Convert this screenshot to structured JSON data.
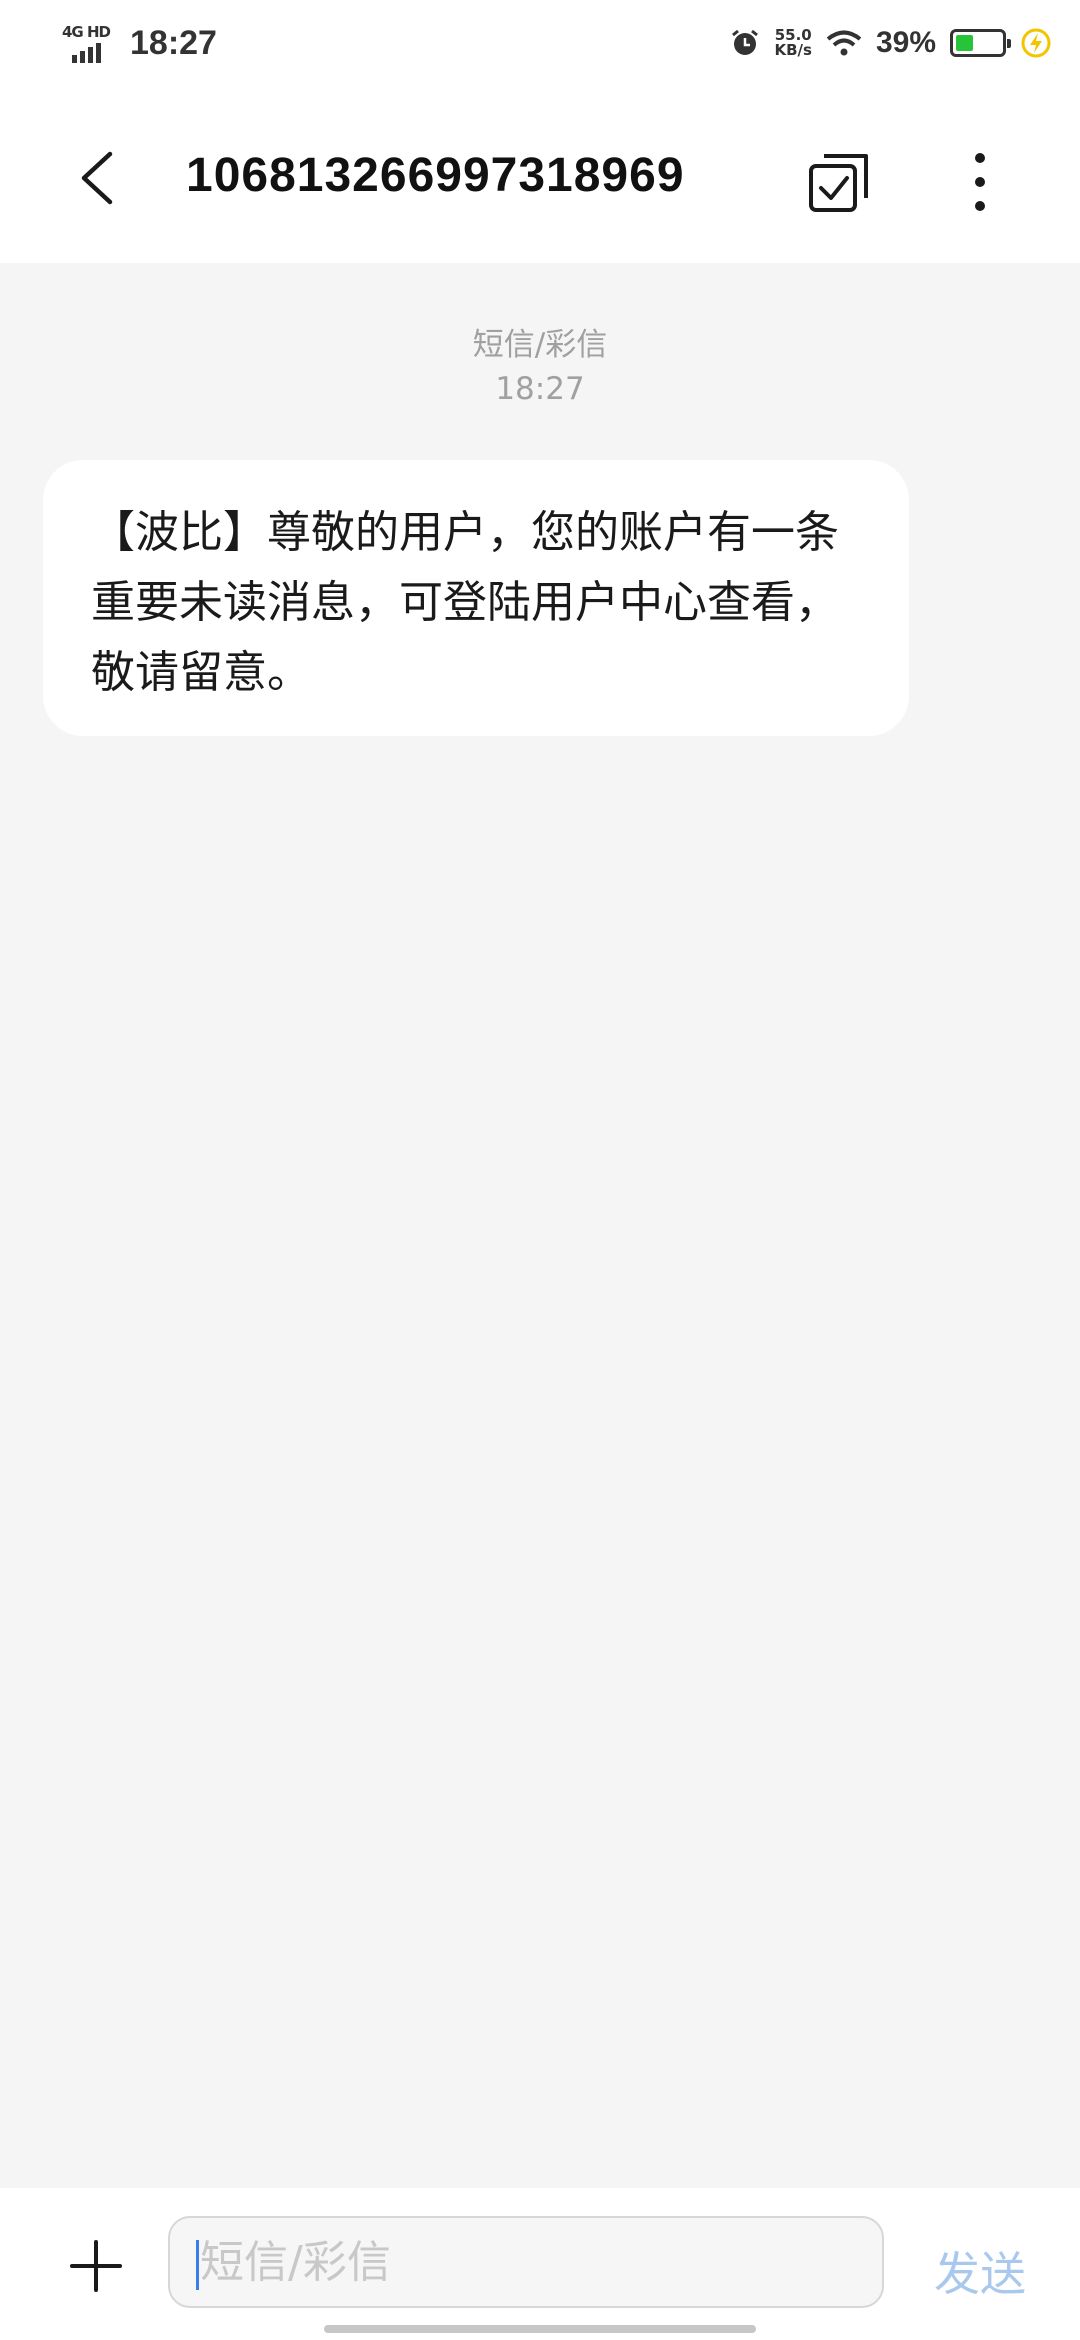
{
  "status_bar": {
    "network": "4G HD",
    "time": "18:27",
    "speed_value": "55.0",
    "speed_unit": "KB/s",
    "battery_percent": "39%",
    "battery_level": 0.39,
    "icons": [
      "signal-icon",
      "alarm-icon",
      "wifi-icon",
      "battery-icon",
      "charging-icon"
    ]
  },
  "header": {
    "title": "106813266997318969",
    "back_icon": "chevron-left-icon",
    "select_icon": "select-checkbox-icon",
    "more_icon": "more-vertical-icon"
  },
  "conversation": {
    "message_type": "短信/彩信",
    "time": "18:27",
    "messages": [
      {
        "text": "【波比】尊敬的用户，您的账户有一条重要未读消息，可登陆用户中心查看，敬请留意。"
      }
    ]
  },
  "composer": {
    "add_icon": "plus-icon",
    "placeholder": "短信/彩信",
    "value": "",
    "send_label": "发送"
  },
  "colors": {
    "background": "#f5f5f5",
    "bubble": "#ffffff",
    "send_disabled": "#a9c8ee",
    "battery_fill": "#27c43a",
    "caret": "#3b7ee5"
  }
}
